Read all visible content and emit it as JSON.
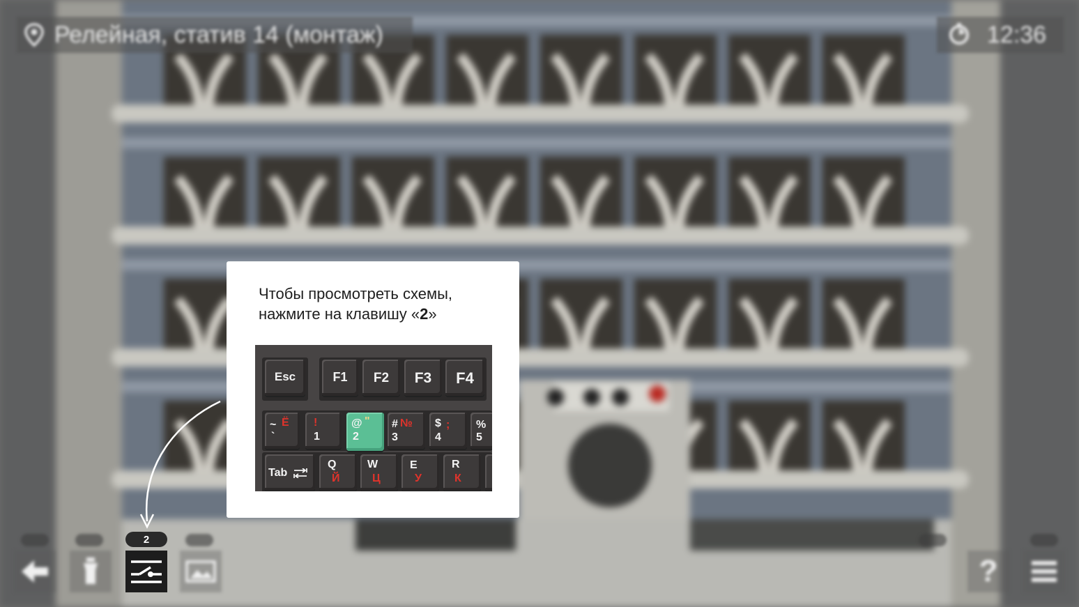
{
  "location": {
    "label": "Релейная, статив 14 (монтаж)",
    "icon": "location-pin-icon"
  },
  "clock": {
    "time": "12:36",
    "icon": "clock-icon"
  },
  "tooltip": {
    "line1": "Чтобы просмотреть схемы,",
    "line2_prefix": "нажмите на клавишу «",
    "line2_key": "2",
    "line2_suffix": "»"
  },
  "keyboard": {
    "function_row": [
      {
        "label": "Esc"
      },
      {
        "label": "F1"
      },
      {
        "label": "F2"
      },
      {
        "label": "F3"
      },
      {
        "label": "F4"
      }
    ],
    "number_row": [
      {
        "top": "~",
        "top_cyr": "Ё",
        "bottom": "`"
      },
      {
        "top": "!",
        "bottom": "1"
      },
      {
        "top": "@",
        "top_cyr": "\"",
        "bottom": "2",
        "highlighted": true
      },
      {
        "top": "#",
        "top_cyr": "№",
        "bottom": "3"
      },
      {
        "top": "$",
        "top_cyr": ";",
        "bottom": "4"
      },
      {
        "top": "%",
        "bottom": "5"
      }
    ],
    "letter_row": [
      {
        "label": "Tab"
      },
      {
        "lat": "Q",
        "cyr": "Й"
      },
      {
        "lat": "W",
        "cyr": "Ц"
      },
      {
        "lat": "E",
        "cyr": "У"
      },
      {
        "lat": "R",
        "cyr": "К"
      }
    ],
    "highlight_color": "#5bbf95"
  },
  "toolbar": {
    "schemes_hotkey": "2",
    "items": [
      {
        "icon": "back-arrow-icon"
      },
      {
        "icon": "flashlight-icon"
      },
      {
        "icon": "schemes-icon",
        "active": true
      },
      {
        "icon": "photo-icon"
      },
      {
        "icon": "help-icon",
        "label": "?"
      },
      {
        "icon": "menu-icon"
      }
    ]
  }
}
